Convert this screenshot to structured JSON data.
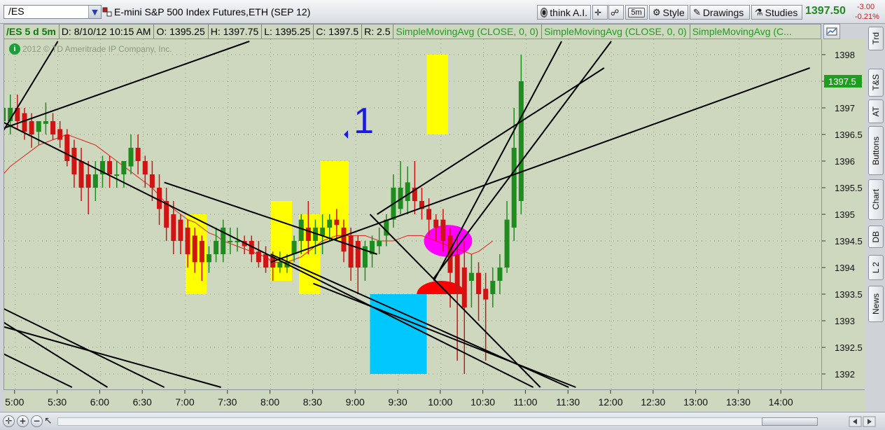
{
  "toolbar": {
    "symbol": "/ES",
    "description": "E-mini S&P 500 Index Futures,ETH (SEP 12)",
    "think_ai_label": "think A.I.",
    "timeframe_label": "5m",
    "style_label": "Style",
    "drawings_label": "Drawings",
    "studies_label": "Studies",
    "last_price": "1397.50",
    "net_change": "-3.00",
    "percent_change": "-0.21%"
  },
  "infobar": {
    "symbol_period": "/ES 5 d 5m",
    "date": "D: 8/10/12 10:15 AM",
    "open": "O: 1395.25",
    "high": "H: 1397.75",
    "low": "L: 1395.25",
    "close": "C: 1397.5",
    "range": "R: 2.5",
    "study_1": "SimpleMovingAvg (CLOSE, 0, 0)",
    "study_2": "SimpleMovingAvg (CLOSE, 0, 0)",
    "study_3": "SimpleMovingAvg (C..."
  },
  "copyright": "2012 © TD Ameritrade IP Company, Inc.",
  "annotation_label": "1",
  "price_tag": "1397.5",
  "side_tabs": [
    "Trd",
    "T&S",
    "AT",
    "Buttons",
    "Chart",
    "DB",
    "L 2",
    "News"
  ],
  "colors": {
    "chart_bg": "#cdd8bf",
    "up_candle": "#1e8c1e",
    "down_candle": "#d01414",
    "sma": "#e0201c",
    "price_tag": "#1e9e1e",
    "highlight_yellow": "#ffff00",
    "highlight_blue": "#00c8ff",
    "magenta": "#ff00ff"
  },
  "chart_data": {
    "type": "candlestick",
    "ylim": [
      1391.75,
      1398.25
    ],
    "y_ticks": [
      "1392",
      "1392.5",
      "1393",
      "1393.5",
      "1394",
      "1394.5",
      "1395",
      "1395.5",
      "1396",
      "1396.5",
      "1397",
      "1397.5",
      "1398"
    ],
    "x_ticks": [
      "5:00",
      "5:30",
      "6:00",
      "6:30",
      "7:00",
      "7:30",
      "8:00",
      "8:30",
      "9:00",
      "9:30",
      "10:00",
      "10:30",
      "11:00",
      "11:30",
      "12:00",
      "12:30",
      "13:00",
      "13:30",
      "14:00"
    ],
    "start_time": "4:50",
    "bar_minutes": 5,
    "candles": [
      {
        "o": 1396.75,
        "h": 1397.25,
        "l": 1396.5,
        "c": 1397.0
      },
      {
        "o": 1396.75,
        "h": 1397.25,
        "l": 1396.5,
        "c": 1397.0
      },
      {
        "o": 1397.0,
        "h": 1397.25,
        "l": 1396.6,
        "c": 1396.75
      },
      {
        "o": 1396.9,
        "h": 1397.0,
        "l": 1396.4,
        "c": 1396.55
      },
      {
        "o": 1396.75,
        "h": 1396.9,
        "l": 1396.25,
        "c": 1396.5
      },
      {
        "o": 1396.55,
        "h": 1396.75,
        "l": 1396.3,
        "c": 1396.75
      },
      {
        "o": 1396.7,
        "h": 1397.1,
        "l": 1396.5,
        "c": 1396.75
      },
      {
        "o": 1396.75,
        "h": 1396.9,
        "l": 1396.4,
        "c": 1396.5
      },
      {
        "o": 1396.6,
        "h": 1396.75,
        "l": 1396.25,
        "c": 1396.4
      },
      {
        "o": 1396.5,
        "h": 1396.6,
        "l": 1395.9,
        "c": 1396.0
      },
      {
        "o": 1396.25,
        "h": 1396.4,
        "l": 1395.5,
        "c": 1395.75
      },
      {
        "o": 1396.0,
        "h": 1396.25,
        "l": 1395.25,
        "c": 1395.5
      },
      {
        "o": 1395.75,
        "h": 1396.0,
        "l": 1395.0,
        "c": 1395.5
      },
      {
        "o": 1395.5,
        "h": 1396.0,
        "l": 1395.25,
        "c": 1395.75
      },
      {
        "o": 1395.75,
        "h": 1396.1,
        "l": 1395.5,
        "c": 1396.0
      },
      {
        "o": 1396.0,
        "h": 1396.1,
        "l": 1395.5,
        "c": 1395.75
      },
      {
        "o": 1395.75,
        "h": 1396.0,
        "l": 1395.5,
        "c": 1395.75
      },
      {
        "o": 1395.75,
        "h": 1396.0,
        "l": 1395.5,
        "c": 1396.0
      },
      {
        "o": 1395.9,
        "h": 1396.5,
        "l": 1395.75,
        "c": 1396.25
      },
      {
        "o": 1396.25,
        "h": 1396.5,
        "l": 1395.75,
        "c": 1396.0
      },
      {
        "o": 1396.0,
        "h": 1396.1,
        "l": 1395.5,
        "c": 1395.75
      },
      {
        "o": 1395.75,
        "h": 1396.0,
        "l": 1395.25,
        "c": 1395.5
      },
      {
        "o": 1395.5,
        "h": 1395.75,
        "l": 1394.8,
        "c": 1395.1
      },
      {
        "o": 1395.25,
        "h": 1395.5,
        "l": 1394.5,
        "c": 1394.75
      },
      {
        "o": 1395.0,
        "h": 1395.25,
        "l": 1394.25,
        "c": 1394.5
      },
      {
        "o": 1394.9,
        "h": 1395.0,
        "l": 1394.25,
        "c": 1394.5
      },
      {
        "o": 1394.75,
        "h": 1394.9,
        "l": 1394.0,
        "c": 1394.25
      },
      {
        "o": 1394.6,
        "h": 1394.75,
        "l": 1393.9,
        "c": 1394.1
      },
      {
        "o": 1394.5,
        "h": 1394.6,
        "l": 1393.75,
        "c": 1394.1
      },
      {
        "o": 1394.1,
        "h": 1394.4,
        "l": 1393.9,
        "c": 1394.25
      },
      {
        "o": 1394.25,
        "h": 1394.75,
        "l": 1394.1,
        "c": 1394.5
      },
      {
        "o": 1394.25,
        "h": 1394.9,
        "l": 1394.1,
        "c": 1394.75
      },
      {
        "o": 1394.5,
        "h": 1394.75,
        "l": 1394.25,
        "c": 1394.5
      },
      {
        "o": 1394.5,
        "h": 1394.75,
        "l": 1394.3,
        "c": 1394.5
      },
      {
        "o": 1394.5,
        "h": 1394.6,
        "l": 1394.25,
        "c": 1394.4
      },
      {
        "o": 1394.5,
        "h": 1394.6,
        "l": 1394.1,
        "c": 1394.25
      },
      {
        "o": 1394.3,
        "h": 1394.5,
        "l": 1394.0,
        "c": 1394.1
      },
      {
        "o": 1394.25,
        "h": 1394.4,
        "l": 1393.9,
        "c": 1394.0
      },
      {
        "o": 1394.2,
        "h": 1394.3,
        "l": 1393.75,
        "c": 1394.0
      },
      {
        "o": 1394.0,
        "h": 1394.3,
        "l": 1393.9,
        "c": 1394.1
      },
      {
        "o": 1394.0,
        "h": 1394.25,
        "l": 1393.9,
        "c": 1394.1
      },
      {
        "o": 1394.25,
        "h": 1394.6,
        "l": 1394.1,
        "c": 1394.5
      },
      {
        "o": 1394.5,
        "h": 1395.0,
        "l": 1394.25,
        "c": 1394.9
      },
      {
        "o": 1394.75,
        "h": 1395.25,
        "l": 1394.25,
        "c": 1394.5
      },
      {
        "o": 1394.5,
        "h": 1394.9,
        "l": 1394.25,
        "c": 1394.75
      },
      {
        "o": 1394.6,
        "h": 1395.0,
        "l": 1394.25,
        "c": 1394.75
      },
      {
        "o": 1394.75,
        "h": 1395.0,
        "l": 1394.5,
        "c": 1394.9
      },
      {
        "o": 1394.9,
        "h": 1395.1,
        "l": 1394.5,
        "c": 1394.8
      },
      {
        "o": 1394.75,
        "h": 1394.9,
        "l": 1394.1,
        "c": 1394.3
      },
      {
        "o": 1394.6,
        "h": 1394.75,
        "l": 1393.75,
        "c": 1394.0
      },
      {
        "o": 1394.5,
        "h": 1394.6,
        "l": 1393.5,
        "c": 1394.0
      },
      {
        "o": 1394.0,
        "h": 1394.5,
        "l": 1393.75,
        "c": 1394.4
      },
      {
        "o": 1394.25,
        "h": 1394.6,
        "l": 1394.0,
        "c": 1394.5
      },
      {
        "o": 1394.4,
        "h": 1394.75,
        "l": 1394.25,
        "c": 1394.5
      },
      {
        "o": 1394.6,
        "h": 1395.0,
        "l": 1394.4,
        "c": 1394.9
      },
      {
        "o": 1394.9,
        "h": 1395.75,
        "l": 1394.75,
        "c": 1395.5
      },
      {
        "o": 1395.1,
        "h": 1396.0,
        "l": 1395.0,
        "c": 1395.5
      },
      {
        "o": 1395.25,
        "h": 1395.9,
        "l": 1395.0,
        "c": 1395.6
      },
      {
        "o": 1395.5,
        "h": 1396.0,
        "l": 1395.0,
        "c": 1395.25
      },
      {
        "o": 1395.25,
        "h": 1395.5,
        "l": 1394.9,
        "c": 1395.1
      },
      {
        "o": 1395.1,
        "h": 1395.3,
        "l": 1394.6,
        "c": 1394.9
      },
      {
        "o": 1394.9,
        "h": 1395.0,
        "l": 1394.5,
        "c": 1394.75
      },
      {
        "o": 1394.9,
        "h": 1395.1,
        "l": 1394.3,
        "c": 1394.5
      },
      {
        "o": 1394.6,
        "h": 1394.75,
        "l": 1393.25,
        "c": 1393.9
      },
      {
        "o": 1394.25,
        "h": 1394.6,
        "l": 1392.25,
        "c": 1393.5
      },
      {
        "o": 1394.0,
        "h": 1394.5,
        "l": 1392.0,
        "c": 1393.25
      },
      {
        "o": 1393.75,
        "h": 1394.25,
        "l": 1393.25,
        "c": 1393.9
      },
      {
        "o": 1393.9,
        "h": 1394.1,
        "l": 1393.0,
        "c": 1393.5
      },
      {
        "o": 1393.6,
        "h": 1393.9,
        "l": 1392.25,
        "c": 1393.4
      },
      {
        "o": 1393.5,
        "h": 1394.0,
        "l": 1393.25,
        "c": 1393.75
      },
      {
        "o": 1393.75,
        "h": 1394.25,
        "l": 1393.5,
        "c": 1394.0
      },
      {
        "o": 1394.0,
        "h": 1395.25,
        "l": 1393.9,
        "c": 1394.9
      },
      {
        "o": 1394.75,
        "h": 1397.0,
        "l": 1394.5,
        "c": 1396.25
      },
      {
        "o": 1395.25,
        "h": 1398.0,
        "l": 1395.0,
        "c": 1397.5
      }
    ],
    "sma": [
      1395.75,
      1395.9,
      1396.0,
      1396.1,
      1396.2,
      1396.3,
      1396.35,
      1396.4,
      1396.45,
      1396.5,
      1396.45,
      1396.4,
      1396.35,
      1396.3,
      1396.2,
      1396.1,
      1396.0,
      1395.9,
      1395.8,
      1395.7,
      1395.6,
      1395.5,
      1395.35,
      1395.2,
      1395.1,
      1395.0,
      1394.9,
      1394.85,
      1394.75,
      1394.65,
      1394.6,
      1394.5,
      1394.45,
      1394.4,
      1394.35,
      1394.3,
      1394.25,
      1394.2,
      1394.1,
      1394.1,
      1394.1,
      1394.15,
      1394.2,
      1394.3,
      1394.4,
      1394.5,
      1394.55,
      1394.6,
      1394.6,
      1394.6,
      1394.6,
      1394.6,
      1394.55,
      1394.5,
      1394.5,
      1394.5,
      1394.55,
      1394.6,
      1394.6,
      1394.6,
      1394.55,
      1394.5,
      1394.45,
      1394.4,
      1394.35,
      1394.3,
      1394.25,
      1394.3,
      1394.4,
      1394.5
    ],
    "highlight_boxes": [
      {
        "color": "yellow",
        "t0": "7:00",
        "t1": "7:15",
        "p_low": 1393.5,
        "p_high": 1395.0
      },
      {
        "color": "yellow",
        "t0": "8:00",
        "t1": "8:15",
        "p_low": 1393.75,
        "p_high": 1395.25
      },
      {
        "color": "yellow",
        "t0": "8:20",
        "t1": "8:35",
        "p_low": 1393.5,
        "p_high": 1395.0
      },
      {
        "color": "yellow",
        "t0": "8:35",
        "t1": "8:55",
        "p_low": 1394.5,
        "p_high": 1396.0
      },
      {
        "color": "yellow",
        "t0": "9:50",
        "t1": "10:05",
        "p_low": 1396.5,
        "p_high": 1398.0
      },
      {
        "color": "cyan",
        "t0": "9:10",
        "t1": "9:50",
        "p_low": 1392.0,
        "p_high": 1393.5
      }
    ],
    "trend_lines": [
      {
        "t0": "4:50",
        "p0": 1396.5,
        "t1": "5:30",
        "p1": 1398.25
      },
      {
        "t0": "4:50",
        "p0": 1396.6,
        "t1": "7:45",
        "p1": 1398.25
      },
      {
        "t0": "4:50",
        "p0": 1396.75,
        "t1": "11:05",
        "p1": 1391.75
      },
      {
        "t0": "4:50",
        "p0": 1393.25,
        "t1": "6:45",
        "p1": 1391.75
      },
      {
        "t0": "4:50",
        "p0": 1393.0,
        "t1": "6:05",
        "p1": 1391.75
      },
      {
        "t0": "4:50",
        "p0": 1392.4,
        "t1": "5:40",
        "p1": 1391.75
      },
      {
        "t0": "4:50",
        "p0": 1392.9,
        "t1": "7:25",
        "p1": 1391.75
      },
      {
        "t0": "8:00",
        "p0": 1394.1,
        "t1": "14:20",
        "p1": 1397.75
      },
      {
        "t0": "8:00",
        "p0": 1394.25,
        "t1": "11:30",
        "p1": 1391.75
      },
      {
        "t0": "8:30",
        "p0": 1393.7,
        "t1": "11:35",
        "p1": 1391.75
      },
      {
        "t0": "9:10",
        "p0": 1395.0,
        "t1": "11:10",
        "p1": 1391.75
      },
      {
        "t0": "9:15",
        "p0": 1395.0,
        "t1": "11:55",
        "p1": 1397.75
      },
      {
        "t0": "9:55",
        "p0": 1393.75,
        "t1": "11:25",
        "p1": 1398.25
      },
      {
        "t0": "9:55",
        "p0": 1393.8,
        "t1": "12:00",
        "p1": 1398.25
      },
      {
        "t0": "6:45",
        "p0": 1395.6,
        "t1": "9:15",
        "p1": 1394.25
      }
    ],
    "ellipses": [
      {
        "color": "magenta",
        "t": "10:05",
        "p": 1394.5,
        "rt_min": 17,
        "rp": 0.3
      },
      {
        "color": "red",
        "t": "10:00",
        "p": 1393.5,
        "rt_min": 17,
        "rp": 0.3
      }
    ],
    "annotation": {
      "t": "8:55",
      "p": 1396.5
    },
    "price_tag_value": 1397.5
  }
}
